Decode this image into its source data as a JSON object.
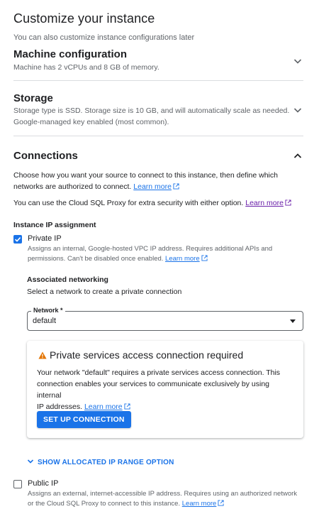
{
  "header": {
    "title": "Customize your instance",
    "subtitle": "You can also customize instance configurations later"
  },
  "machine": {
    "title": "Machine configuration",
    "desc": "Machine has 2 vCPUs and 8 GB of memory.",
    "icon": "chevron-down-icon"
  },
  "storage": {
    "title": "Storage",
    "desc1": "Storage type is SSD. Storage size is 10 GB, and will automatically scale as needed.",
    "desc2": "Google-managed key enabled (most common).",
    "icon": "chevron-down-icon"
  },
  "connections": {
    "title": "Connections",
    "icon": "chevron-up-icon",
    "intro_line1": "Choose how you want your source to connect to this instance, then define which",
    "intro_line2": "networks are authorized to connect.",
    "learn_more": "Learn more",
    "proxy_text": "You can use the Cloud SQL Proxy for extra security with either option.",
    "proxy_learn_more": "Learn more",
    "ip_assignment_label": "Instance IP assignment",
    "private_ip": {
      "label": "Private IP",
      "checked": true,
      "desc_line1": "Assigns an internal, Google-hosted VPC IP address. Requires additional APIs and",
      "desc_line2": "permissions. Can't be disabled once enabled.",
      "learn_more": "Learn more"
    },
    "assoc_networking": {
      "title": "Associated networking",
      "desc": "Select a network to create a private connection",
      "network_label": "Network *",
      "network_value": "default"
    },
    "psa_card": {
      "title": "Private services access connection required",
      "text_line1": "Your network \"default\" requires a private services access connection. This",
      "text_line2": "connection enables your services to communicate exclusively by using internal",
      "text_line3": "IP addresses.",
      "learn_more": "Learn more",
      "button": "SET UP CONNECTION",
      "warn_color": "#e37400"
    },
    "show_range": "SHOW ALLOCATED IP RANGE OPTION",
    "public_ip": {
      "label": "Public IP",
      "checked": false,
      "desc_line1": "Assigns an external, internet-accessible IP address. Requires using an authorized network",
      "desc_line2": "or the Cloud SQL Proxy to connect to this instance.",
      "learn_more": "Learn more"
    }
  },
  "colors": {
    "accent": "#1a73e8",
    "visited_link": "#681da8",
    "text": "#202124",
    "muted": "#5f6368"
  }
}
